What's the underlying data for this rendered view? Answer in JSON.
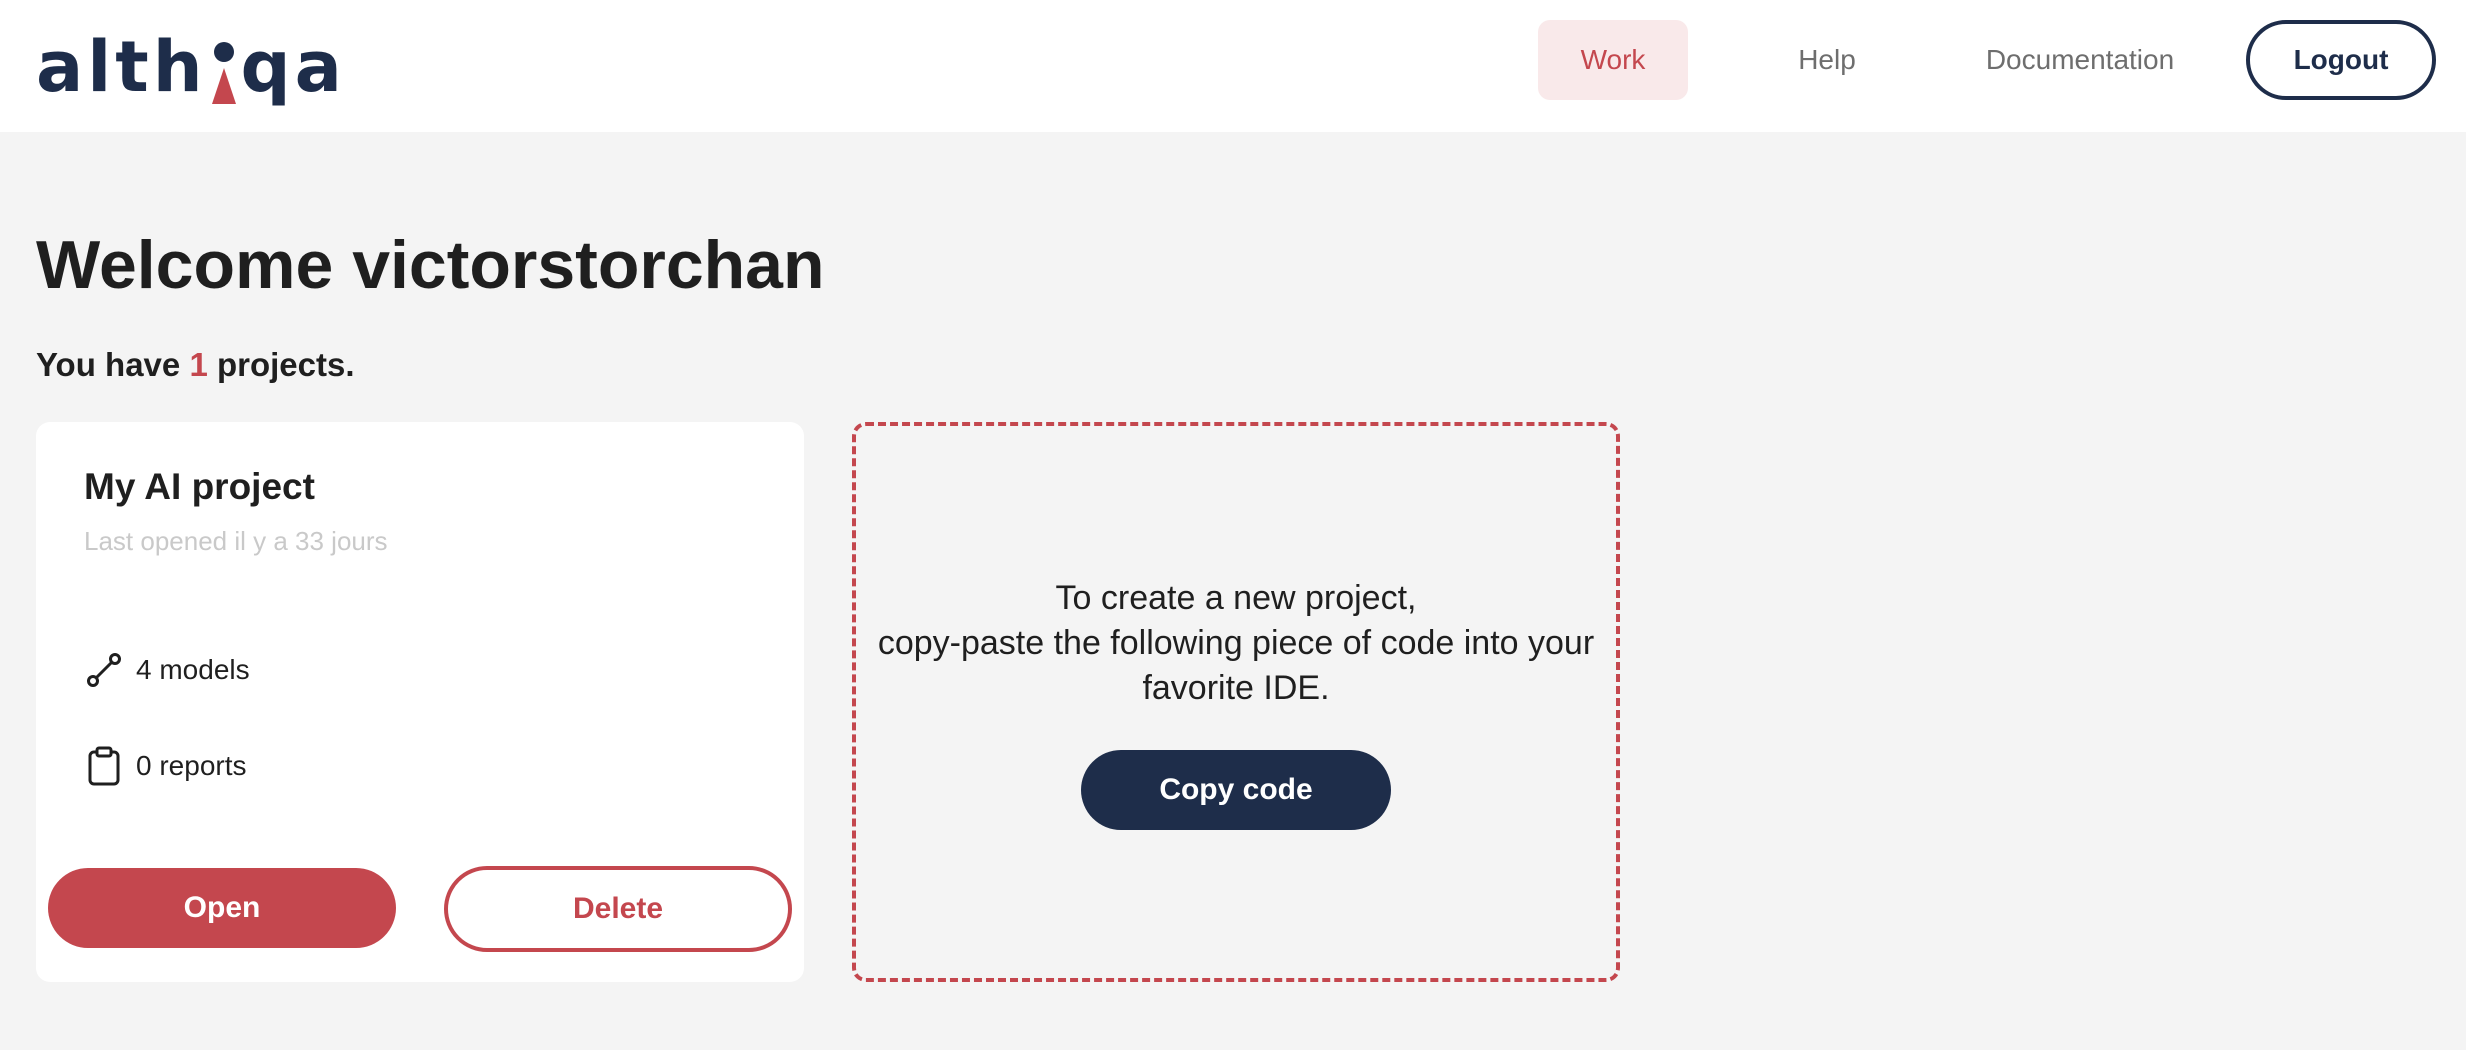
{
  "header": {
    "logo": {
      "part1": "alth",
      "part2": "qa"
    },
    "nav": {
      "work": "Work",
      "help": "Help",
      "documentation": "Documentation"
    },
    "logout_label": "Logout"
  },
  "main": {
    "welcome": "Welcome victorstorchan",
    "projects_prefix": "You have",
    "projects_count": "1",
    "projects_suffix": "projects."
  },
  "project_card": {
    "title": "My AI project",
    "last_opened": "Last opened il y a 33 jours",
    "models": "4 models",
    "models_icon": "path-icon",
    "reports": "0 reports",
    "reports_icon": "clipboard-icon",
    "open_label": "Open",
    "delete_label": "Delete"
  },
  "new_project": {
    "line1": "To create a new project,",
    "line2": "copy-paste the following piece of code into your",
    "line3": "favorite IDE.",
    "copy_label": "Copy code"
  },
  "colors": {
    "accent_red": "#c4474e",
    "navy": "#1e2d4a",
    "background": "#f4f4f4",
    "work_highlight": "#f9e9ea"
  }
}
